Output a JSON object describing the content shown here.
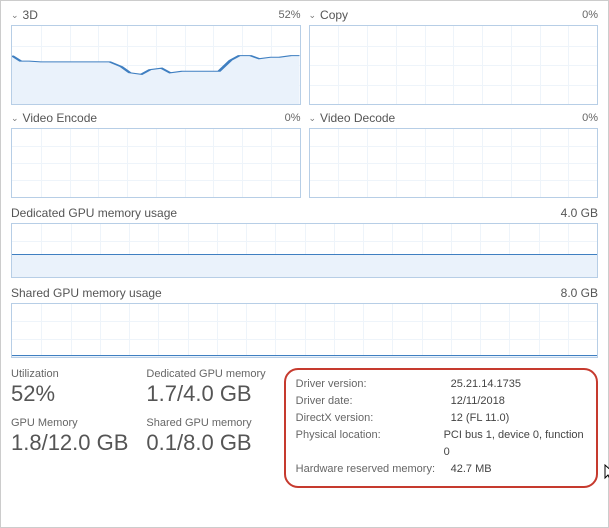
{
  "panels": {
    "p3d": {
      "title": "3D",
      "percent": "52%"
    },
    "copy": {
      "title": "Copy",
      "percent": "0%"
    },
    "venc": {
      "title": "Video Encode",
      "percent": "0%"
    },
    "vdec": {
      "title": "Video Decode",
      "percent": "0%"
    }
  },
  "dedicated": {
    "title": "Dedicated GPU memory usage",
    "max": "4.0 GB"
  },
  "shared": {
    "title": "Shared GPU memory usage",
    "max": "8.0 GB"
  },
  "stats": {
    "util": {
      "label": "Utilization",
      "value": "52%"
    },
    "ded": {
      "label": "Dedicated GPU memory",
      "value": "1.7/4.0 GB"
    },
    "gmem": {
      "label": "GPU Memory",
      "value": "1.8/12.0 GB"
    },
    "shared": {
      "label": "Shared GPU memory",
      "value": "0.1/8.0 GB"
    }
  },
  "info": {
    "driver_version": {
      "k": "Driver version:",
      "v": "25.21.14.1735"
    },
    "driver_date": {
      "k": "Driver date:",
      "v": "12/11/2018"
    },
    "directx": {
      "k": "DirectX version:",
      "v": "12 (FL 11.0)"
    },
    "location": {
      "k": "Physical location:",
      "v": "PCI bus 1, device 0, function 0"
    },
    "reserved": {
      "k": "Hardware reserved memory:",
      "v": "42.7 MB"
    }
  },
  "chart_data": [
    {
      "type": "line",
      "title": "3D",
      "ylim": [
        0,
        100
      ],
      "x": [
        0,
        1,
        2,
        3,
        4,
        5,
        6,
        7,
        8,
        9,
        10,
        11,
        12,
        13,
        14,
        15,
        16,
        17,
        18,
        19,
        20,
        21,
        22,
        23,
        24,
        25,
        26,
        27,
        28,
        29
      ],
      "values": [
        62,
        55,
        55,
        54,
        54,
        54,
        54,
        54,
        54,
        54,
        54,
        48,
        40,
        38,
        44,
        46,
        40,
        42,
        42,
        42,
        42,
        42,
        56,
        62,
        62,
        58,
        60,
        60,
        62,
        62
      ]
    },
    {
      "type": "line",
      "title": "Copy",
      "ylim": [
        0,
        100
      ],
      "values": [
        0
      ]
    },
    {
      "type": "line",
      "title": "Video Encode",
      "ylim": [
        0,
        100
      ],
      "values": [
        0
      ]
    },
    {
      "type": "line",
      "title": "Video Decode",
      "ylim": [
        0,
        100
      ],
      "values": [
        0
      ]
    },
    {
      "type": "area",
      "title": "Dedicated GPU memory usage",
      "ylim": [
        0,
        4.0
      ],
      "unit": "GB",
      "values": [
        1.7
      ]
    },
    {
      "type": "area",
      "title": "Shared GPU memory usage",
      "ylim": [
        0,
        8.0
      ],
      "unit": "GB",
      "values": [
        0.1
      ]
    }
  ]
}
